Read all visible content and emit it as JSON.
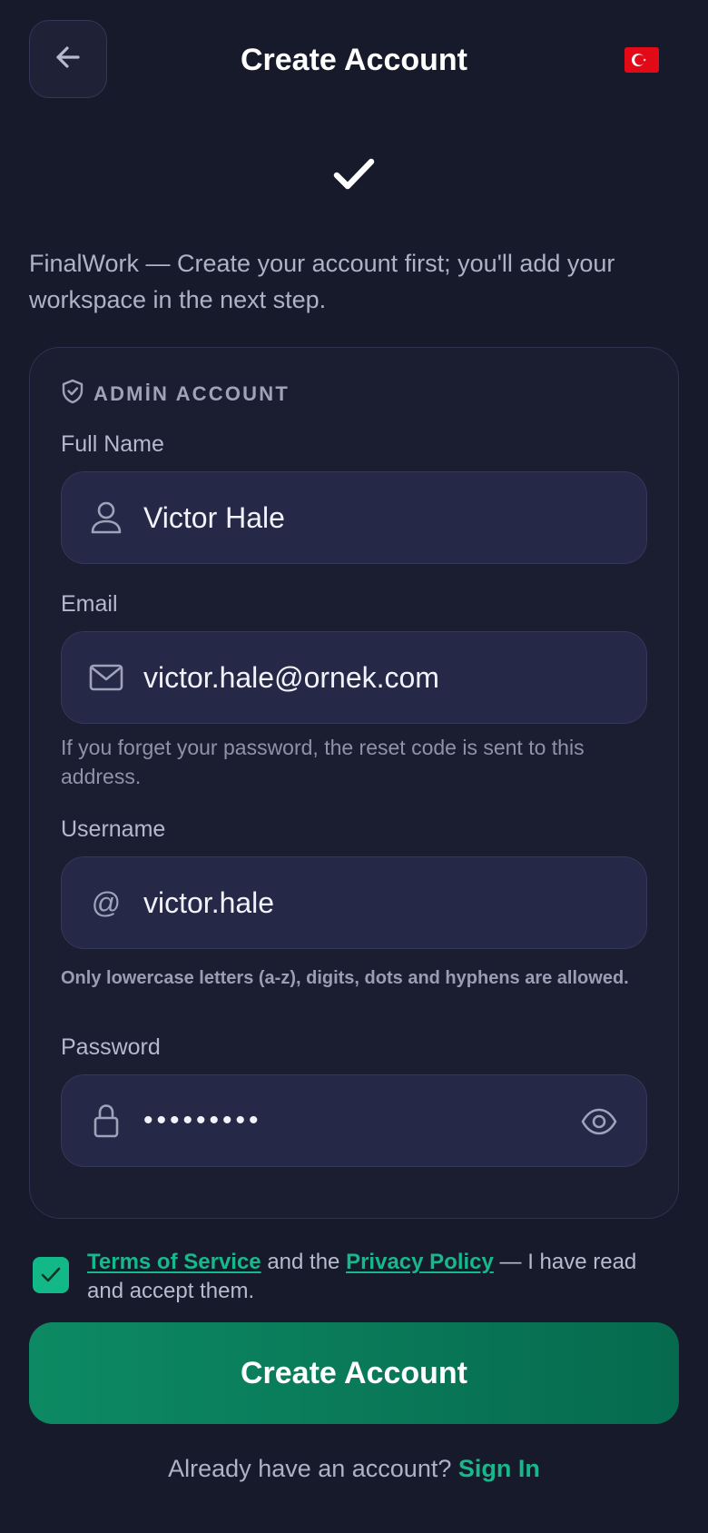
{
  "header": {
    "title": "Create Account",
    "back_icon": "arrow-left-icon",
    "language_flag": "turkey-flag-icon"
  },
  "intro": "FinalWork — Create your account first; you'll add your workspace in the next step.",
  "card": {
    "section_title": "ADMİN ACCOUNT",
    "section_icon": "shield-icon",
    "full_name": {
      "label": "Full Name",
      "value": "Victor Hale",
      "icon": "user-icon"
    },
    "email": {
      "label": "Email",
      "value": "victor.hale@ornek.com",
      "icon": "mail-icon",
      "help": "If you forget your password, the reset code is sent to this address."
    },
    "username": {
      "label": "Username",
      "value": "victor.hale",
      "icon": "@",
      "help": "Only lowercase letters (a-z), digits, dots and hyphens are allowed."
    },
    "password": {
      "label": "Password",
      "value": "•••••••••",
      "icon": "lock-icon",
      "toggle_icon": "eye-icon"
    }
  },
  "terms": {
    "checked": true,
    "tos": "Terms of Service",
    "and_the": " and the ",
    "privacy": "Privacy Policy",
    "suffix": " — I have read and accept them."
  },
  "submit_label": "Create Account",
  "signin": {
    "prompt": "Already have an account? ",
    "link": "Sign In"
  },
  "colors": {
    "background": "#171a2b",
    "accent": "#17b88b",
    "button": "#0d8a63",
    "flag_red": "#e30a17"
  }
}
